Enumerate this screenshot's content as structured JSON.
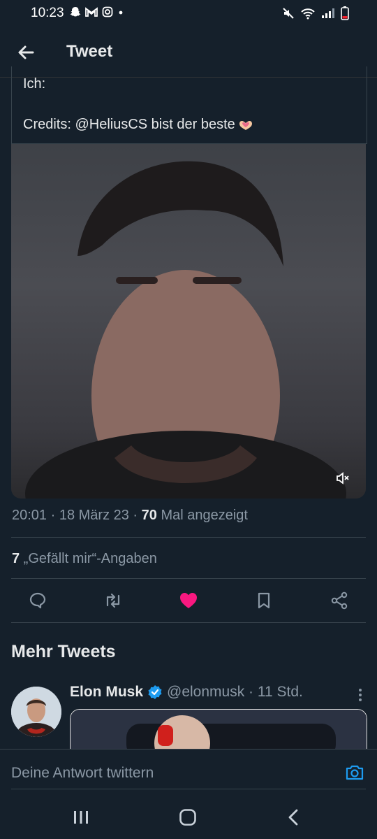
{
  "status_bar": {
    "time": "10:23"
  },
  "header": {
    "title": "Tweet"
  },
  "quoted_tweet": {
    "line1": "Ich:",
    "line2": "Credits: @HeliusCS bist der beste"
  },
  "tweet_meta": {
    "time_date": "20:01 · 18 März 23 · ",
    "views_count": "70",
    "views_label": " Mal angezeigt"
  },
  "likes": {
    "count": "7",
    "label": " „Gefällt mir“-Angaben"
  },
  "actions": {
    "liked_color": "#f91880"
  },
  "more_tweets": {
    "title": "Mehr Tweets",
    "first": {
      "name": "Elon Musk",
      "handle_time": "@elonmusk · 11 Std."
    }
  },
  "reply": {
    "placeholder": "Deine Antwort twittern"
  },
  "colors": {
    "background": "#15202b",
    "accent": "#1d9bf0",
    "secondary_text": "#8b98a5"
  }
}
